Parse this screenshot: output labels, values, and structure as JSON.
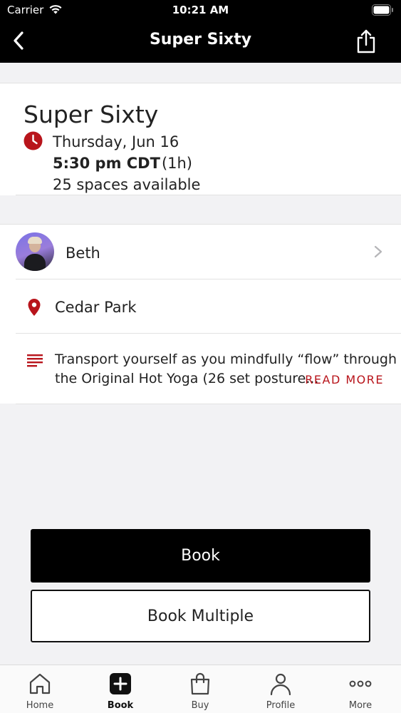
{
  "status_bar": {
    "carrier": "Carrier",
    "time": "10:21 AM"
  },
  "nav": {
    "title": "Super Sixty",
    "back_icon": "chevron-left-icon",
    "share_icon": "share-icon"
  },
  "class_info": {
    "title": "Super Sixty",
    "date": "Thursday, Jun 16",
    "time": "5:30 pm CDT",
    "duration": "(1h)",
    "spaces": "25 spaces available",
    "icon": "clock-icon"
  },
  "details": {
    "instructor": "Beth",
    "location": "Cedar Park",
    "description_line1": "Transport yourself as you mindfully “flow” through",
    "description_line2": "the Original Hot Yoga (26 set posture...",
    "read_more": "READ MORE"
  },
  "actions": {
    "book": "Book",
    "book_multiple": "Book Multiple"
  },
  "tab_bar": {
    "tabs": [
      {
        "label": "Home",
        "icon": "home-icon"
      },
      {
        "label": "Book",
        "icon": "plus-square-icon",
        "active": true
      },
      {
        "label": "Buy",
        "icon": "shopping-bag-icon"
      },
      {
        "label": "Profile",
        "icon": "person-icon"
      },
      {
        "label": "More",
        "icon": "more-dots-icon"
      }
    ]
  },
  "colors": {
    "accent_red": "#b8141b",
    "header_bg": "#000000"
  }
}
